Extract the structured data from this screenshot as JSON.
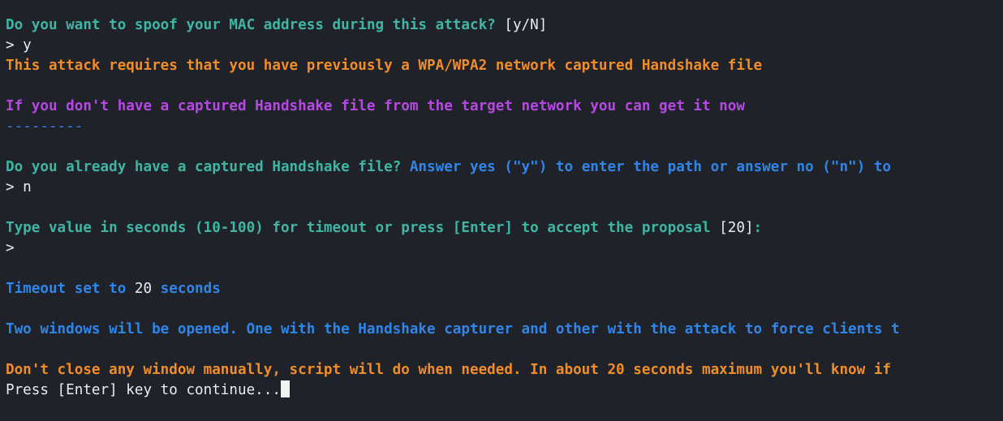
{
  "colors": {
    "background": "#1f2229",
    "green": "#3fb5a3",
    "orange": "#f08d2a",
    "purple": "#b648e3",
    "blue": "#2f86e8",
    "white": "#e9ecef"
  },
  "terminal": {
    "spoof_question": "Do you want to spoof your MAC address during this attack?",
    "spoof_options": "[y/N]",
    "spoof_answer": "> y",
    "requirement_notice": "This attack requires that you have previously a WPA/WPA2 network captured Handshake file",
    "capture_hint": "If you don't have a captured Handshake file from the target network you can get it now",
    "separator": "---------",
    "handshake_question": "Do you already have a captured Handshake file?",
    "handshake_instruction": "Answer yes (\"y\") to enter the path or answer no (\"n\") to",
    "handshake_answer": "> n",
    "timeout_question_part1": "Type value in seconds (10-100) for timeout or press [Enter] to accept the proposal ",
    "timeout_default": "[20]",
    "timeout_question_part2": ":",
    "timeout_prompt": ">",
    "timeout_set_prefix": "Timeout set to ",
    "timeout_value": "20",
    "timeout_set_suffix": " seconds",
    "windows_notice": "Two windows will be opened. One with the Handshake capturer and other with the attack to force clients t",
    "close_warning": "Don't close any window manually, script will do when needed. In about 20 seconds maximum you'll know if",
    "continue_prompt": "Press [Enter] key to continue..."
  }
}
